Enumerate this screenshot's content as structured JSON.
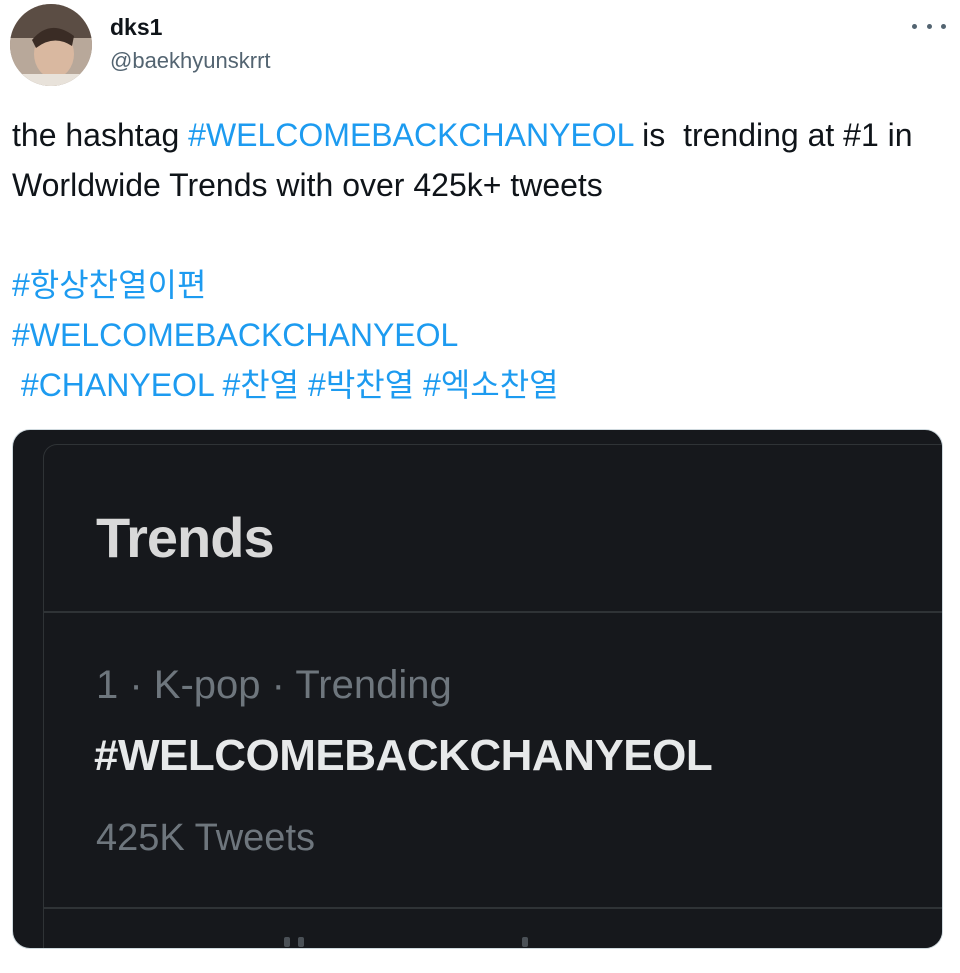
{
  "author": {
    "display_name": "dks1",
    "handle": "@baekhyunskrrt",
    "avatar_icon": "user-avatar"
  },
  "more_icon": "more-horizontal-icon",
  "tweet": {
    "intro_1": "the hashtag ",
    "hashtag_main": "#WELCOMEBACKCHANYEOL",
    "intro_2": " is  trending at #1 in Worldwide Trends with over 425k+ tweets",
    "hashtags": [
      "#항상찬열이편",
      "#WELCOMEBACKCHANYEOL",
      "#CHANYEOL",
      "#찬열",
      "#박찬열",
      "#엑소찬열"
    ],
    "colors": {
      "text": "#0f1419",
      "link": "#1d9bf0"
    }
  },
  "media": {
    "trends_title": "Trends",
    "trend": {
      "meta": "1 · K-pop · Trending",
      "name": "#WELCOMEBACKCHANYEOL",
      "count": "425K Tweets"
    },
    "colors": {
      "background": "#16181c",
      "divider": "#2f3336"
    }
  }
}
